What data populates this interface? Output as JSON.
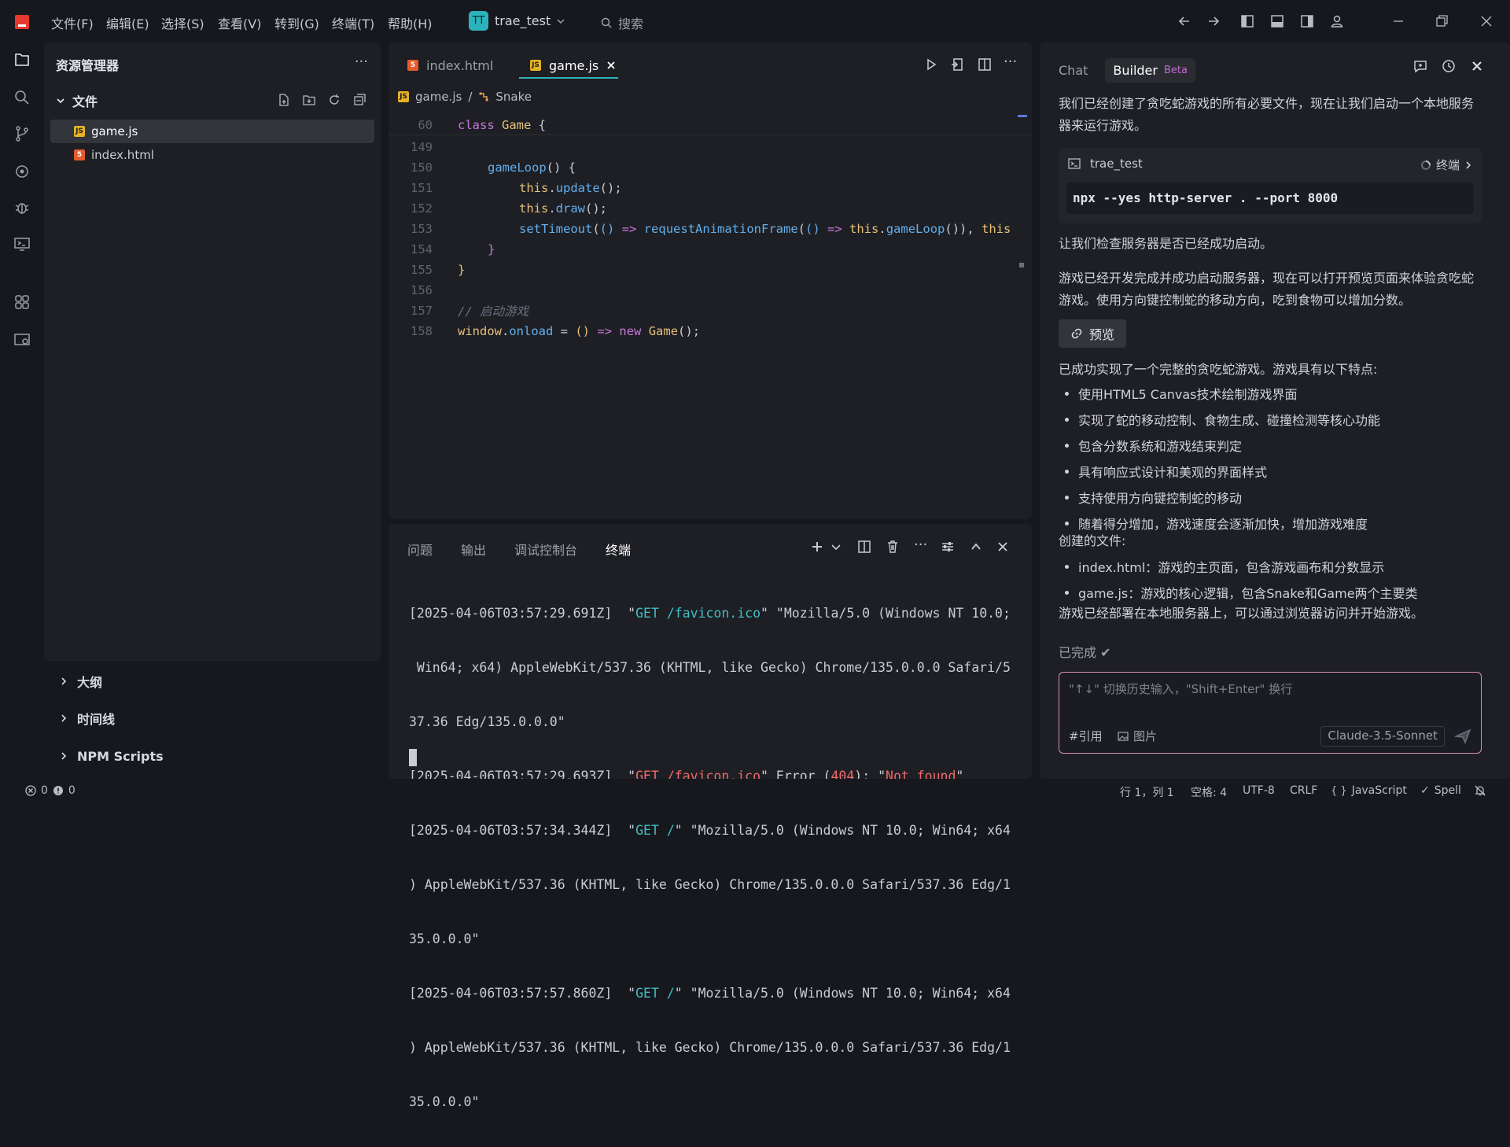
{
  "titlebar": {
    "menus": [
      "文件(F)",
      "编辑(E)",
      "选择(S)",
      "查看(V)",
      "转到(G)",
      "终端(T)",
      "帮助(H)"
    ],
    "project_badge": "TT",
    "project_name": "trae_test",
    "search_label": "搜索"
  },
  "sidebar": {
    "title": "资源管理器",
    "more": "···",
    "folder_label": "文件",
    "files": [
      {
        "name": "game.js",
        "type": "js"
      },
      {
        "name": "index.html",
        "type": "html"
      }
    ],
    "sections": [
      "大纲",
      "时间线",
      "NPM Scripts"
    ]
  },
  "editor": {
    "tabs": [
      {
        "label": "index.html",
        "type": "html"
      },
      {
        "label": "game.js",
        "type": "js"
      }
    ],
    "breadcrumb": {
      "file": "game.js",
      "symbol": "Snake"
    },
    "sticky_line": {
      "num": "60",
      "text": "class Game {"
    },
    "lines": [
      {
        "num": "149",
        "text": ""
      },
      {
        "num": "150",
        "text": "gameLoop() {"
      },
      {
        "num": "151",
        "text": "this.update();"
      },
      {
        "num": "152",
        "text": "this.draw();"
      },
      {
        "num": "153",
        "text": "setTimeout(() => requestAnimationFrame(() => this.gameLoop()), this"
      },
      {
        "num": "154",
        "text": "}"
      },
      {
        "num": "155",
        "text": "}"
      },
      {
        "num": "156",
        "text": ""
      },
      {
        "num": "157",
        "text": "// 启动游戏"
      },
      {
        "num": "158",
        "text": "window.onload = () => new Game();"
      }
    ]
  },
  "panel": {
    "tabs": [
      "问题",
      "输出",
      "调试控制台",
      "终端"
    ],
    "terminal_lines": [
      "[2025-04-06T03:57:29.691Z]  \"GET /favicon.ico\" \"Mozilla/5.0 (Windows NT 10.0;",
      " Win64; x64) AppleWebKit/537.36 (KHTML, like Gecko) Chrome/135.0.0.0 Safari/5",
      "37.36 Edg/135.0.0.0\"",
      "[2025-04-06T03:57:29.693Z]  \"GET /favicon.ico\" Error (404): \"Not found\"",
      "[2025-04-06T03:57:34.344Z]  \"GET /\" \"Mozilla/5.0 (Windows NT 10.0; Win64; x64",
      ") AppleWebKit/537.36 (KHTML, like Gecko) Chrome/135.0.0.0 Safari/537.36 Edg/1",
      "35.0.0.0\"",
      "[2025-04-06T03:57:57.860Z]  \"GET /\" \"Mozilla/5.0 (Windows NT 10.0; Win64; x64",
      ") AppleWebKit/537.36 (KHTML, like Gecko) Chrome/135.0.0.0 Safari/537.36 Edg/1",
      "35.0.0.0\""
    ]
  },
  "chat": {
    "tab_chat": "Chat",
    "tab_builder": "Builder",
    "beta": "Beta",
    "intro": "我们已经创建了贪吃蛇游戏的所有必要文件，现在让我们启动一个本地服务器来运行游戏。",
    "term_card": {
      "name": "trae_test",
      "action": "终端",
      "command": "npx --yes http-server . --port 8000"
    },
    "check": "让我们检查服务器是否已经成功启动。",
    "ready": "游戏已经开发完成并成功启动服务器，现在可以打开预览页面来体验贪吃蛇游戏。使用方向键控制蛇的移动方向，吃到食物可以增加分数。",
    "preview_label": "预览",
    "summary": "已成功实现了一个完整的贪吃蛇游戏。游戏具有以下特点:",
    "features": [
      "使用HTML5 Canvas技术绘制游戏界面",
      "实现了蛇的移动控制、食物生成、碰撞检测等核心功能",
      "包含分数系统和游戏结束判定",
      "具有响应式设计和美观的界面样式",
      "支持使用方向键控制蛇的移动",
      "随着得分增加，游戏速度会逐渐加快，增加游戏难度"
    ],
    "created_label": "创建的文件:",
    "created_files": [
      "index.html：游戏的主页面，包含游戏画布和分数显示",
      "game.js：游戏的核心逻辑，包含Snake和Game两个主要类"
    ],
    "deployed": "游戏已经部署在本地服务器上，可以通过浏览器访问并开始游戏。",
    "done": "已完成 ✔",
    "input_placeholder": "\"↑↓\" 切换历史输入，\"Shift+Enter\" 换行",
    "ref_label": "#引用",
    "image_label": "图片",
    "model": "Claude-3.5-Sonnet"
  },
  "status": {
    "errors": "0",
    "warnings": "0",
    "position": "行 1，列 1",
    "spaces": "空格: 4",
    "encoding": "UTF-8",
    "eol": "CRLF",
    "language": "JavaScript",
    "spell": "Spell"
  }
}
